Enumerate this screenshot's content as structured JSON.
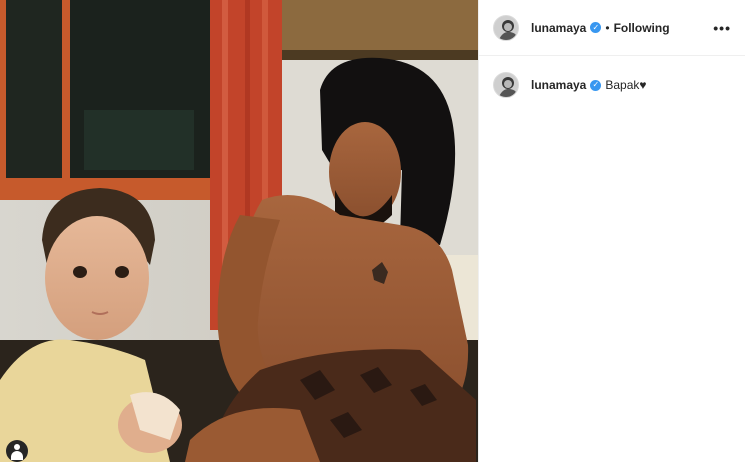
{
  "post": {
    "author": {
      "username": "lunamaya",
      "verified": true,
      "verified_glyph": "✓"
    },
    "header": {
      "separator": "•",
      "follow_status": "Following",
      "more_label": "•••"
    },
    "caption": {
      "username": "lunamaya",
      "text": "Bapak♥"
    },
    "icons": {
      "verified": "verified-badge-icon",
      "more": "more-options-icon",
      "tag": "user-tag-icon"
    },
    "colors": {
      "verified_blue": "#3897f0",
      "text": "#262626",
      "divider": "#efefef"
    }
  }
}
